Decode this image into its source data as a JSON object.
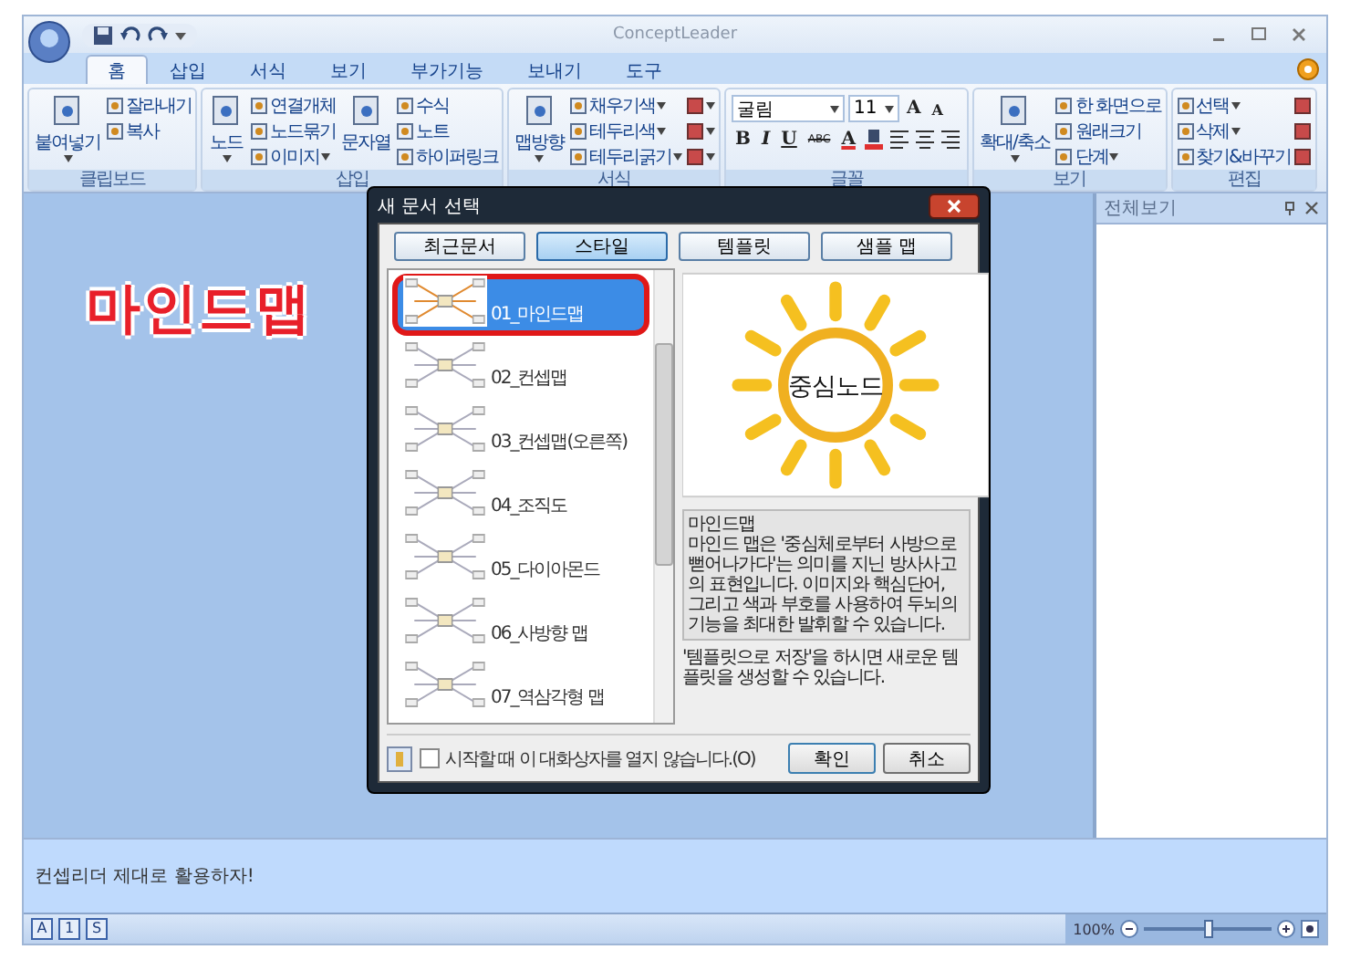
{
  "window": {
    "title": "ConceptLeader"
  },
  "ribbon_tabs": [
    {
      "label": "홈",
      "selected": true
    },
    {
      "label": "삽입",
      "selected": false
    },
    {
      "label": "서식",
      "selected": false
    },
    {
      "label": "보기",
      "selected": false
    },
    {
      "label": "부가기능",
      "selected": false
    },
    {
      "label": "보내기",
      "selected": false
    },
    {
      "label": "도구",
      "selected": false
    }
  ],
  "ribbon_groups": [
    {
      "kind": "tools",
      "label": "클립보드",
      "items": [
        {
          "kind": "large",
          "label": "붙여넣기",
          "dropdown": true
        },
        {
          "kind": "small",
          "label": "잘라내기",
          "dropdown": false
        },
        {
          "kind": "small",
          "label": "복사",
          "dropdown": false
        }
      ]
    },
    {
      "kind": "tools",
      "label": "삽입",
      "items": [
        {
          "kind": "large",
          "label": "노드",
          "dropdown": true
        },
        {
          "kind": "small",
          "label": "연결개체",
          "dropdown": false
        },
        {
          "kind": "small",
          "label": "노드묶기",
          "dropdown": false
        },
        {
          "kind": "small",
          "label": "이미지",
          "dropdown": true
        },
        {
          "kind": "large",
          "label": "문자열",
          "dropdown": false
        },
        {
          "kind": "small",
          "label": "수식",
          "dropdown": false
        },
        {
          "kind": "small",
          "label": "노트",
          "dropdown": false
        },
        {
          "kind": "small",
          "label": "하이퍼링크",
          "dropdown": false
        }
      ]
    },
    {
      "kind": "tools",
      "label": "서식",
      "items": [
        {
          "kind": "large",
          "label": "맵방향",
          "dropdown": true
        },
        {
          "kind": "small",
          "label": "채우기색",
          "dropdown": true
        },
        {
          "kind": "small",
          "label": "테두리색",
          "dropdown": true
        },
        {
          "kind": "small",
          "label": "테두리굵기",
          "dropdown": true
        },
        {
          "kind": "icon",
          "dropdown": true
        },
        {
          "kind": "icon",
          "dropdown": true
        },
        {
          "kind": "icon",
          "dropdown": true
        }
      ]
    },
    {
      "kind": "font",
      "label": "글꼴",
      "font": "굴림",
      "size": "11",
      "size_buttons": [
        "A",
        "A"
      ],
      "format_buttons": [
        "B",
        "I",
        "U",
        "ABC",
        "A"
      ]
    },
    {
      "kind": "tools",
      "label": "보기",
      "items": [
        {
          "kind": "large",
          "label": "확대/축소",
          "dropdown": true
        },
        {
          "kind": "small",
          "label": "한 화면으로",
          "dropdown": false
        },
        {
          "kind": "small",
          "label": "원래크기",
          "dropdown": false
        },
        {
          "kind": "small",
          "label": "단계",
          "dropdown": true
        }
      ]
    },
    {
      "kind": "tools",
      "label": "편집",
      "items": [
        {
          "kind": "small",
          "label": "선택",
          "dropdown": true
        },
        {
          "kind": "small",
          "label": "삭제",
          "dropdown": true
        },
        {
          "kind": "small",
          "label": "찾기&바꾸기",
          "dropdown": false
        },
        {
          "kind": "icon",
          "dropdown": false
        },
        {
          "kind": "icon",
          "dropdown": false
        },
        {
          "kind": "icon",
          "dropdown": false
        }
      ]
    }
  ],
  "side_panel": {
    "title": "전체보기"
  },
  "annotation": {
    "label": "마인드맵"
  },
  "dialog": {
    "title": "새 문서 선택",
    "tabs": [
      {
        "label": "최근문서",
        "selected": false
      },
      {
        "label": "스타일",
        "selected": true
      },
      {
        "label": "템플릿",
        "selected": false
      },
      {
        "label": "샘플 맵",
        "selected": false
      }
    ],
    "templates": [
      {
        "label": "01_마인드맵",
        "selected": true,
        "circled": true
      },
      {
        "label": "02_컨셉맵",
        "selected": false,
        "circled": false
      },
      {
        "label": "03_컨셉맵(오른쪽)",
        "selected": false,
        "circled": false
      },
      {
        "label": "04_조직도",
        "selected": false,
        "circled": false
      },
      {
        "label": "05_다이아몬드",
        "selected": false,
        "circled": false
      },
      {
        "label": "06_사방향 맵",
        "selected": false,
        "circled": false
      },
      {
        "label": "07_역삼각형 맵",
        "selected": false,
        "circled": false
      }
    ],
    "preview": {
      "center_label": "중심노드"
    },
    "description_title": "마인드맵",
    "description": "마인드 맵은 '중심체로부터 사방으로 뻗어나가다'는 의미를 지닌 방사사고의 표현입니다. 이미지와 핵심단어, 그리고 색과 부호를 사용하여 두뇌의 기능을 최대한 발휘할 수 있습니다.",
    "note": "'템플릿으로 저장'을 하시면 새로운 템플릿을 생성할 수 있습니다.",
    "dont_show": {
      "label": "시작할 때 이 대화상자를 열지 않습니다.(O)",
      "checked": false
    },
    "buttons": [
      "확인",
      "취소"
    ]
  },
  "memo": "컨셉리더 제대로 활용하자!",
  "status_bar": {
    "buttons": [
      "A",
      "1",
      "S"
    ],
    "zoom": "100%",
    "zoom_level": {
      "level": 0.5
    }
  }
}
